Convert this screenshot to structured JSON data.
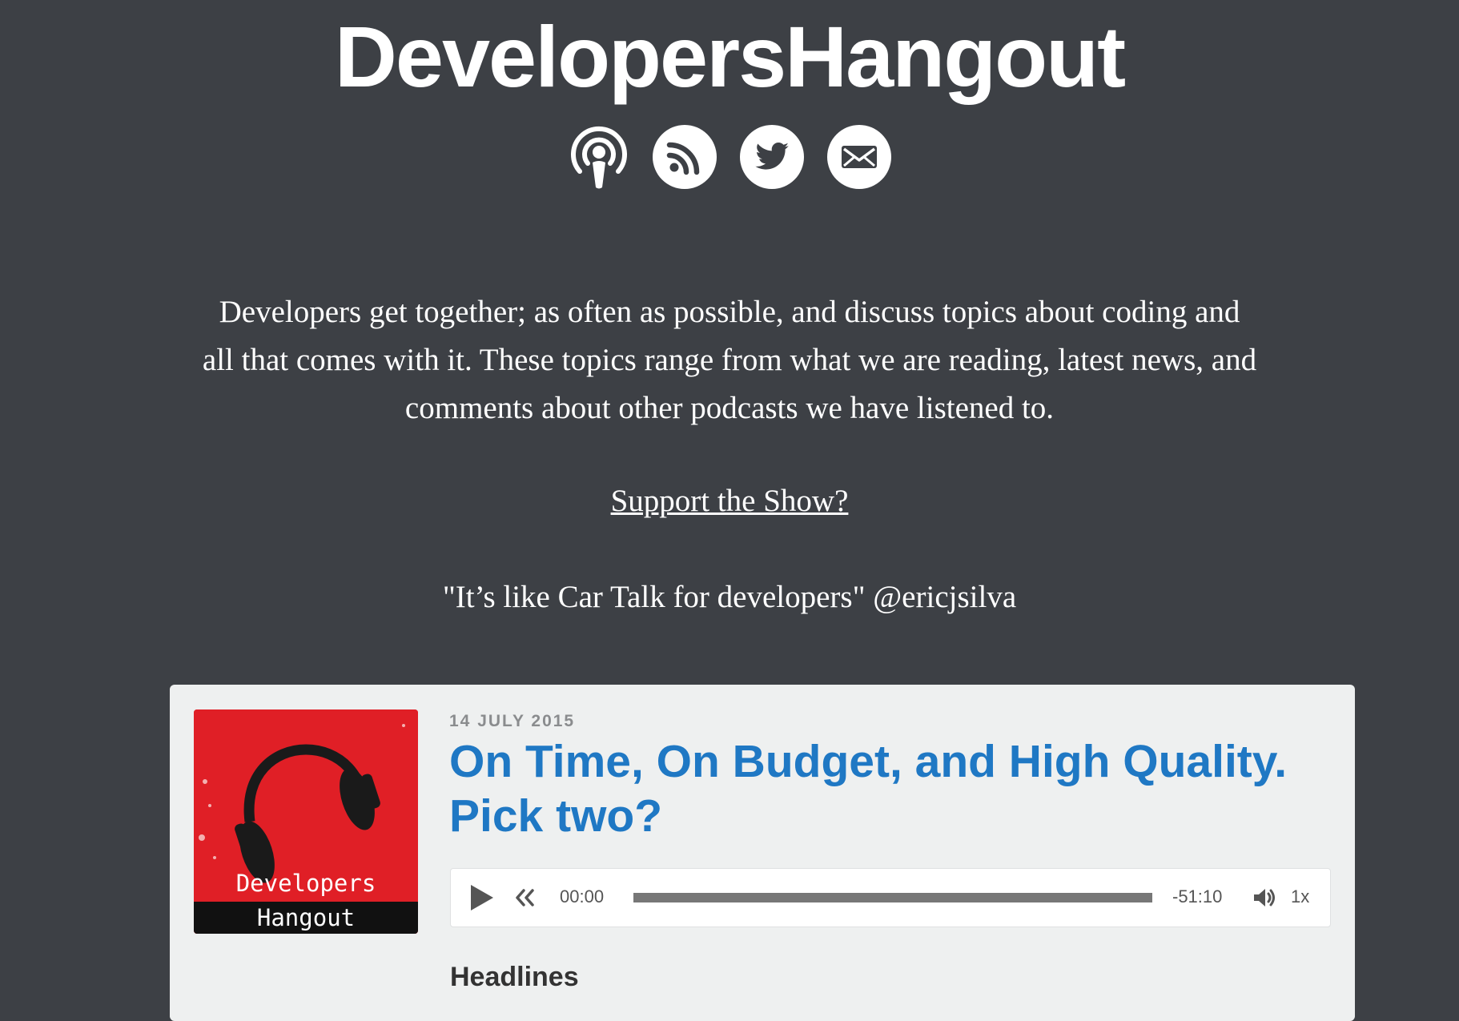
{
  "site": {
    "title": "DevelopersHangout"
  },
  "social": [
    {
      "icon": "podcast-icon"
    },
    {
      "icon": "rss-icon"
    },
    {
      "icon": "twitter-icon"
    },
    {
      "icon": "email-icon"
    }
  ],
  "intro": {
    "description": "Developers get together; as often as possible, and discuss topics about coding and all that comes with it. These topics range from what we are reading, latest news, and comments about other podcasts we have listened to.",
    "support_link": "Support the Show?",
    "quote": "\"It’s like Car Talk for developers\" @ericjsilva"
  },
  "episode": {
    "artwork": {
      "line1": "Developers",
      "line2": "Hangout"
    },
    "date": "14 JULY 2015",
    "title": "On Time, On Budget, and High Quality. Pick two?",
    "player": {
      "current_time": "00:00",
      "remaining_time": "-51:10",
      "speed": "1x",
      "progress": 0
    },
    "section_heading": "Headlines"
  },
  "colors": {
    "background": "#3d4045",
    "card": "#eef0f0",
    "title_link": "#1f78c4",
    "artwork_red": "#e01f26"
  }
}
